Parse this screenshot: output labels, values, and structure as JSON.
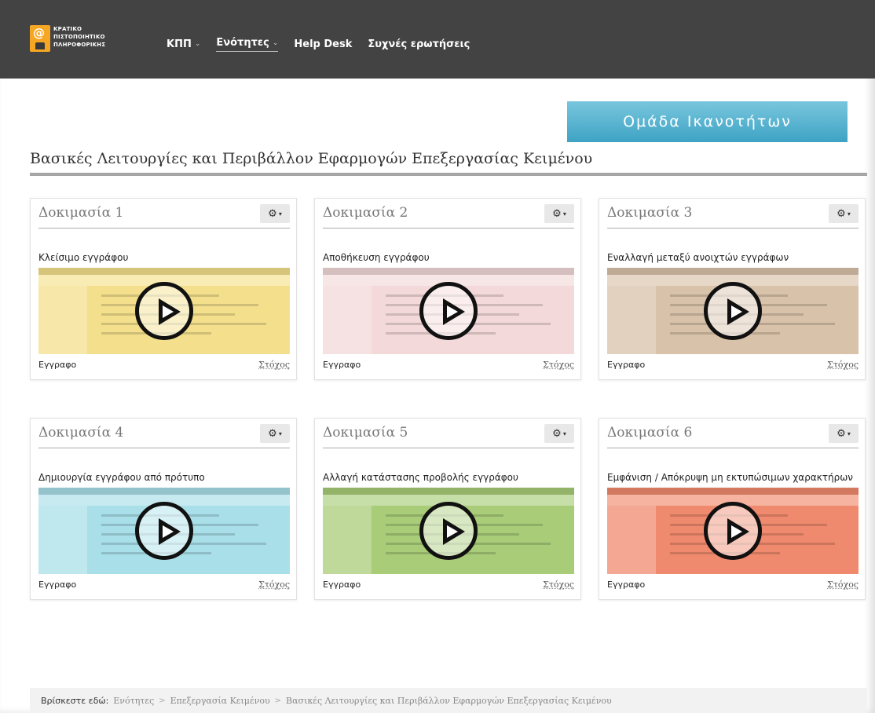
{
  "header": {
    "logo_lines": [
      "ΚΡΑΤΙΚΟ",
      "ΠΙΣΤΟΠΟΙΗΤΙΚΟ",
      "ΠΛΗΡΟΦΟΡΙΚΗΣ"
    ],
    "nav": [
      {
        "label": "ΚΠΠ",
        "dropdown": true
      },
      {
        "label": "Ενότητες",
        "dropdown": true,
        "active": true
      },
      {
        "label": "Help Desk",
        "dropdown": false
      },
      {
        "label": "Συχνές ερωτήσεις",
        "dropdown": false
      }
    ],
    "caret": "⌄"
  },
  "group_button": {
    "label": "Ομάδα Ικανοτήτων",
    "color": "#4aa9c8"
  },
  "page_title": "Βασικές Λειτουργίες και Περιβάλλον Εφαρμογών Επεξεργασίας Κειμένου",
  "cards": [
    {
      "title": "Δοκιμασία 1",
      "subtitle": "Κλείσιμο εγγράφου",
      "left": "Εγγραφο",
      "right": "Στόχος",
      "tint": "#f4e08c"
    },
    {
      "title": "Δοκιμασία 2",
      "subtitle": "Αποθήκευση εγγράφου",
      "left": "Εγγραφο",
      "right": "Στόχος",
      "tint": "#f3d9d9"
    },
    {
      "title": "Δοκιμασία 3",
      "subtitle": "Εναλλαγή μεταξύ ανοιχτών εγγράφων",
      "left": "Εγγραφο",
      "right": "Στόχος",
      "tint": "#d9c2aa"
    },
    {
      "title": "Δοκιμασία 4",
      "subtitle": "Δημιουργία εγγράφου από πρότυπο",
      "left": "Εγγραφο",
      "right": "Στόχος",
      "tint": "#a9dfe9"
    },
    {
      "title": "Δοκιμασία 5",
      "subtitle": "Αλλαγή κατάστασης προβολής εγγράφου",
      "left": "Εγγραφο",
      "right": "Στόχος",
      "tint": "#a8cc78"
    },
    {
      "title": "Δοκιμασία 6",
      "subtitle": "Εμφάνιση / Απόκρυψη μη εκτυπώσιμων χαρακτήρων",
      "left": "Εγγραφο",
      "right": "Στόχος",
      "tint": "#f08a6e"
    }
  ],
  "gear": {
    "icon": "⚙",
    "caret": "▾"
  },
  "breadcrumb": {
    "lead": "Βρίσκεστε εδώ:",
    "items": [
      "Ενότητες",
      "Επεξεργασία Κειμένου",
      "Βασικές Λειτουργίες και Περιβάλλον Εφαρμογών Επεξεργασίας Κειμένου"
    ],
    "separator": ">"
  }
}
